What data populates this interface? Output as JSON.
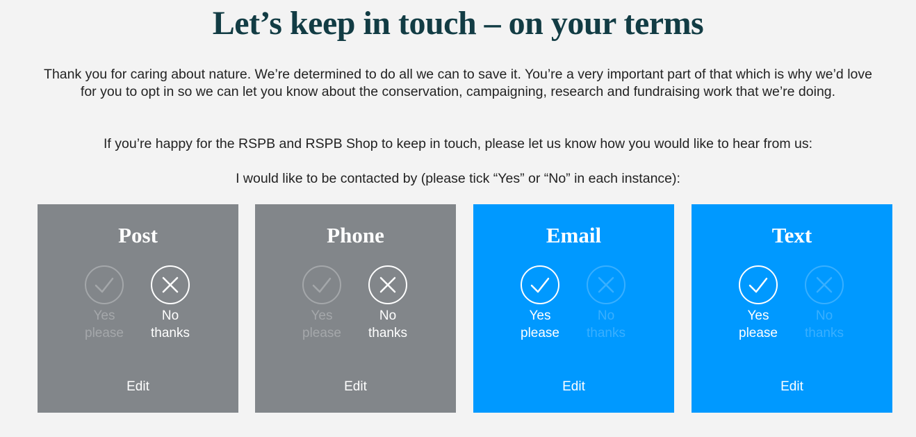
{
  "page": {
    "title": "Let’s keep in touch – on your terms",
    "intro1": "Thank you for caring about nature. We’re determined to do all we can to save it. You’re a very important part of that which is why we’d love for you to opt in so we can let you know about the conservation, campaigning, research and fundraising work that we’re doing.",
    "intro2": "If you’re happy for the RSPB and RSPB Shop to keep in touch, please let us know how you would like to hear from us:",
    "intro3": "I would like to be contacted by (please tick “Yes” or “No” in each instance):"
  },
  "cards": [
    {
      "title": "Post",
      "yes_label_1": "Yes",
      "yes_label_2": "please",
      "no_label_1": "No",
      "no_label_2": "thanks",
      "selected": "no",
      "edit_label": "Edit",
      "color": "#82868a"
    },
    {
      "title": "Phone",
      "yes_label_1": "Yes",
      "yes_label_2": "please",
      "no_label_1": "No",
      "no_label_2": "thanks",
      "selected": "no",
      "edit_label": "Edit",
      "color": "#82868a"
    },
    {
      "title": "Email",
      "yes_label_1": "Yes",
      "yes_label_2": "please",
      "no_label_1": "No",
      "no_label_2": "thanks",
      "selected": "yes",
      "edit_label": "Edit",
      "color": "#0099ff"
    },
    {
      "title": "Text",
      "yes_label_1": "Yes",
      "yes_label_2": "please",
      "no_label_1": "No",
      "no_label_2": "thanks",
      "selected": "yes",
      "edit_label": "Edit",
      "color": "#0099ff"
    }
  ],
  "icons": {
    "yes": "check-icon",
    "no": "cross-icon"
  },
  "colors": {
    "title": "#123c44",
    "background": "#f3f3f3",
    "opted_out_card": "#82868a",
    "opted_in_card": "#0099ff"
  }
}
